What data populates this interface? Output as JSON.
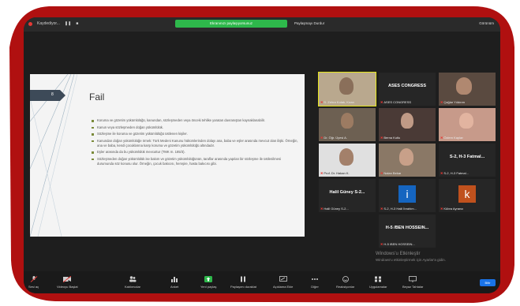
{
  "top_bar": {
    "recording_label": "Kaydediyor...",
    "share_notice": "Ekranınızı paylaşıyorsunuz",
    "stop_share": "Paylaşmayı Durdur",
    "view": "Görünüm"
  },
  "slide": {
    "number": "8",
    "title": "Fail",
    "bullets": [
      "Koruma ve gözetim yükümlülüğü, kanundan, sözleşmeden veya önceki tehlike yaratan davranıştan kaynaklanabilir.",
      "Kanun veya sözleşmeden doğan yükümlülük.",
      "Sözleşme ile koruma ve gözetim yükümlülüğü üstlenen kişiler.",
      "Kanundan doğan yükümlülüğe örnek: Türk Medeni Kanunu hükümlerinden dolayı ana, baba ve eşler arasında mevcut olan ilişki. Örneğin, ana ve baba, kendi çocuklarına karşı koruma ve gözetim yükümlülüğü altındadır.",
      "Eşler arasında da bu yükümlülük mevcuttur (TMK m. 185/3).",
      "Sözleşmeden doğan yükümlülük ise bakım ve gözetim yükümlülüğünün, taraflar arasında yapılan bir sözleşme ile üstlenilmesi durumunda söz konusu olur. Örneğin, çocuk bakıcısı, hemşire, hasta bakıcısı gibi."
    ]
  },
  "participants": [
    {
      "name": "S. Zehra Kıdak, Kıran",
      "type": "video",
      "highlight": true
    },
    {
      "name": "ASES CONGRESS",
      "type": "text"
    },
    {
      "name": "Çağlar Yıldırım",
      "type": "video"
    },
    {
      "name": "Dr. Öğr. Üyesi A.",
      "type": "video"
    },
    {
      "name": "Berna Kutlu",
      "type": "video"
    },
    {
      "name": "Özlem Kaplan",
      "type": "video"
    },
    {
      "name": "Prof. Dr. Hakan K.",
      "type": "video"
    },
    {
      "name": "Nalan Bekar",
      "type": "video"
    },
    {
      "name": "S-2, H-3 Fatmal...",
      "type": "text"
    },
    {
      "name": "Halil Güney S-2...",
      "type": "text"
    },
    {
      "name": "S-2, H-3 Halil İbrahim...",
      "type": "avatar",
      "letter": "i",
      "color": "#1565c0"
    },
    {
      "name": "Kübra Ayrancı",
      "type": "avatar",
      "letter": "k",
      "color": "#c0511d"
    },
    {
      "name": "H-5 /BEN HOSSEIN...",
      "type": "text"
    }
  ],
  "watermark": {
    "title": "Windows'u Etkinleştir",
    "subtitle": "Windows'u etkinleştirmek için Ayarlar'a gidin."
  },
  "controls": [
    {
      "label": "Sesi aç",
      "icon": "mic-icon"
    },
    {
      "label": "Videoyu Başlat",
      "icon": "video-icon"
    },
    {
      "label": "Katılımcılar",
      "icon": "participants-icon"
    },
    {
      "label": "Anket",
      "icon": "poll-icon"
    },
    {
      "label": "Yeni paylaş",
      "icon": "share-icon"
    },
    {
      "label": "Paylaşımı duraklat",
      "icon": "pause-icon"
    },
    {
      "label": "Açıklama Ekle",
      "icon": "annotate-icon"
    },
    {
      "label": "Diğer",
      "icon": "more-icon"
    },
    {
      "label": "Reaksiyonlar",
      "icon": "reactions-icon"
    },
    {
      "label": "Uygulamalar",
      "icon": "apps-icon"
    },
    {
      "label": "Beyaz Tahtalar",
      "icon": "whiteboard-icon"
    }
  ],
  "end_button": "Bitir",
  "colors": {
    "frame": "#b01010",
    "share_green": "#2eb84b",
    "highlight": "#e6e61a",
    "end_blue": "#1a73e8"
  }
}
